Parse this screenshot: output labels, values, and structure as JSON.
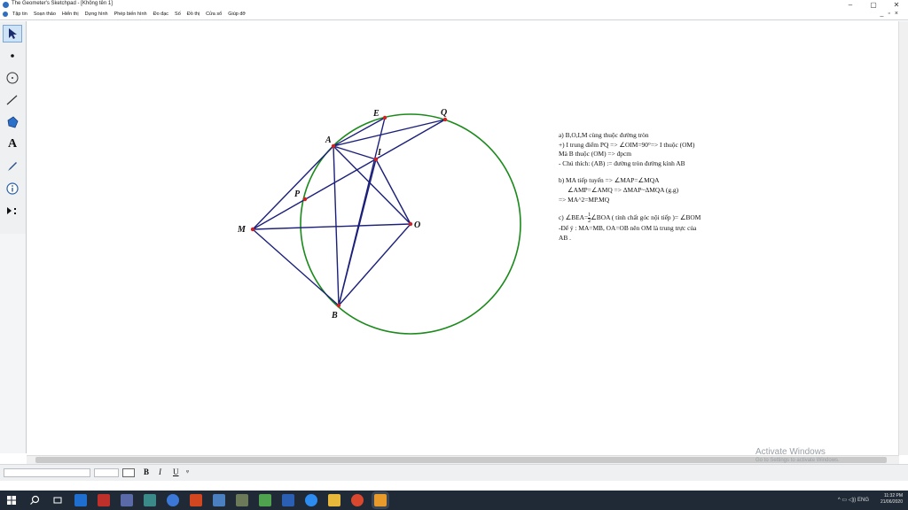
{
  "window": {
    "title": "The Geometer's Sketchpad - [Không tên 1]",
    "controls": [
      "–",
      "▢",
      "✕"
    ],
    "doc_controls": [
      "_",
      "▫",
      "×"
    ]
  },
  "menu": [
    "Tập tin",
    "Soạn thảo",
    "Hiển thị",
    "Dựng hình",
    "Phép biến hình",
    "Đo đạc",
    "Số",
    "Đồ thị",
    "Cửa sổ",
    "Giúp đỡ"
  ],
  "toolbox": {
    "tools": [
      "arrow-tool",
      "point-tool",
      "compass-tool",
      "straightedge-tool",
      "polygon-tool",
      "text-tool",
      "marker-tool",
      "information-tool",
      "custom-tool"
    ],
    "text_tool_label": "A"
  },
  "figure": {
    "points": {
      "E": "E",
      "Q": "Q",
      "A": "A",
      "I": "I",
      "P": "P",
      "M": "M",
      "O": "O",
      "B": "B"
    },
    "colors": {
      "circle": "#1a8a1a",
      "segments": "#1b1f7a",
      "points": "#d42020"
    }
  },
  "notes": {
    "a": [
      "a) B,O,I,M cùng thuộc đường tròn",
      "+) I trung điểm PQ => ∠OIM=90°=> I thuộc (OM)",
      "Mà B thuộc (OM) => đpcm",
      " - Chú thích: (AB) := đường tròn đường kính AB"
    ],
    "b": [
      "b) MA tiếp tuyến => ∠MAP=∠MQA",
      "∠AMP=∠AMQ => ΔMAP~ΔMQA (g.g)",
      "=> MA^2=MP.MQ"
    ],
    "c_prefix": "c) ∠BEA=",
    "c_num": "1",
    "c_den": "2",
    "c_suffix": "∠BOA ( tính chất góc nội tiếp )= ∠BOM",
    "c2": [
      " -Để ý : MA=MB, OA=OB nên OM là trung trực của",
      "AB ."
    ]
  },
  "format_bar": {
    "bold": "B",
    "italic": "I",
    "underline": "U",
    "symbol": "ᵠ"
  },
  "watermark": {
    "line1": "Activate Windows",
    "line2": "Go to Settings to activate Windows."
  },
  "taskbar": {
    "time": "11:32 PM",
    "date": "21/06/2020",
    "lang": "ENG"
  }
}
